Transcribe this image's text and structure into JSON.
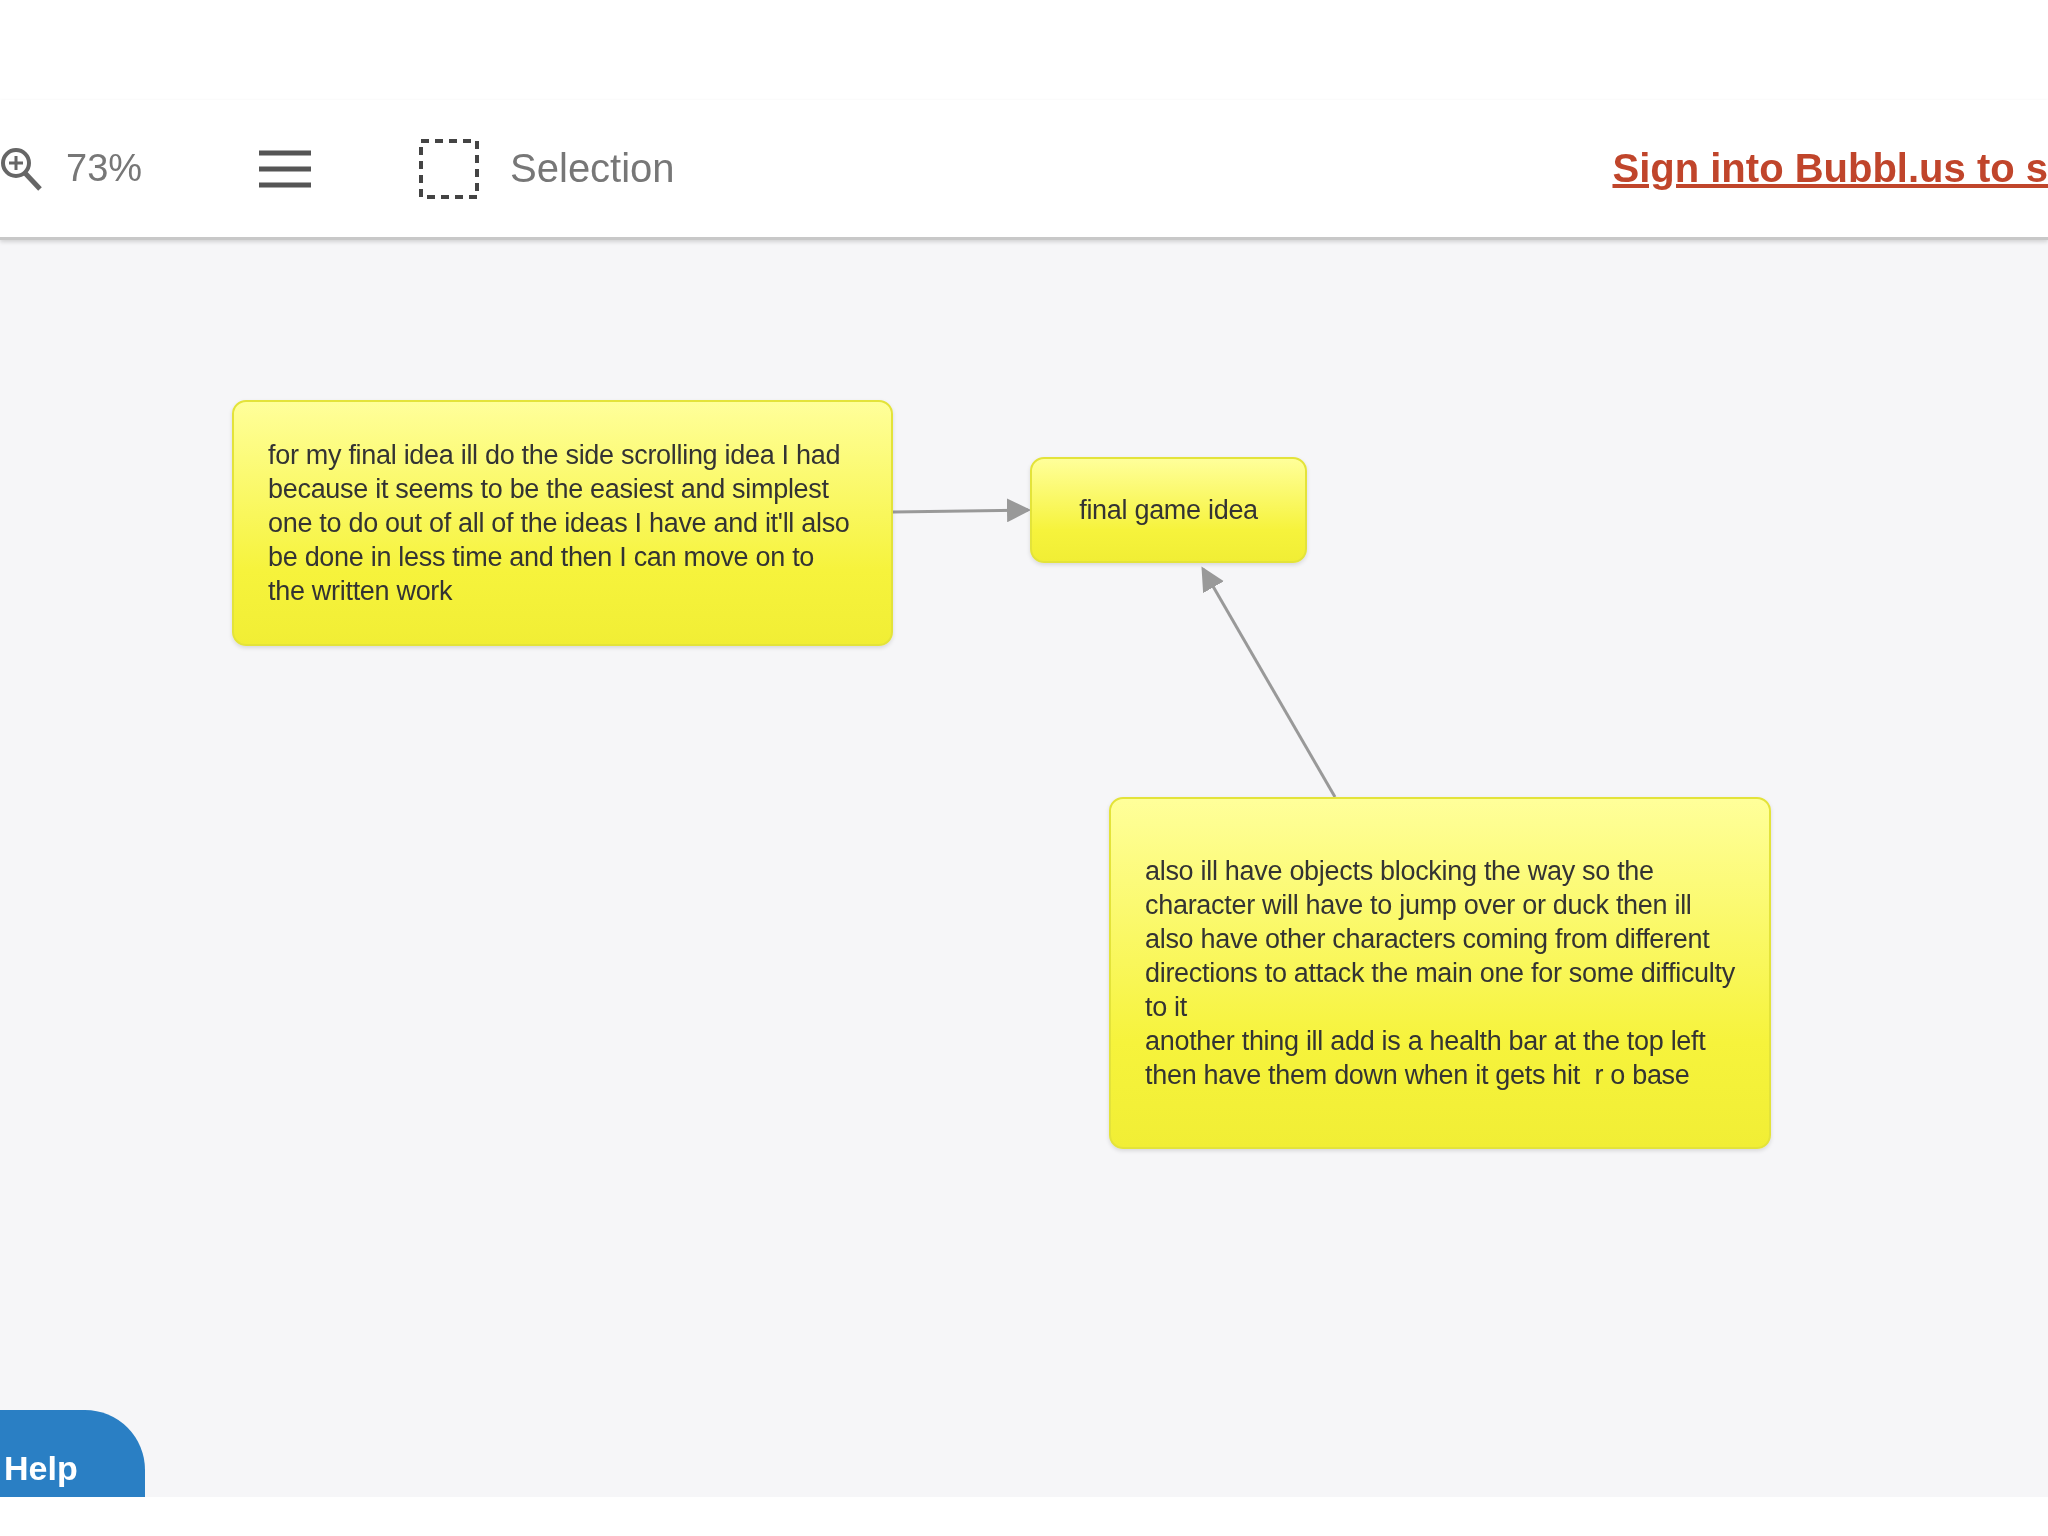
{
  "toolbar": {
    "zoom": "73%",
    "tool": "Selection",
    "sign_in_link": "Sign into Bubbl.us to s"
  },
  "nodes": [
    {
      "text": "for my final idea ill do the side scrolling idea I had because it seems to be the easiest and simplest one to do out of all of the ideas I have and it'll also be done in less time and then I can move on to the written work"
    },
    {
      "text": "final game idea"
    },
    {
      "text": "also ill have objects blocking the way so the character will have to jump over or duck then ill also have other characters coming from different directions to attack the main one for some difficulty to it\nanother thing ill add is a health bar at the top left then have them down when it gets hit  r o base"
    }
  ],
  "help_button": "Help"
}
